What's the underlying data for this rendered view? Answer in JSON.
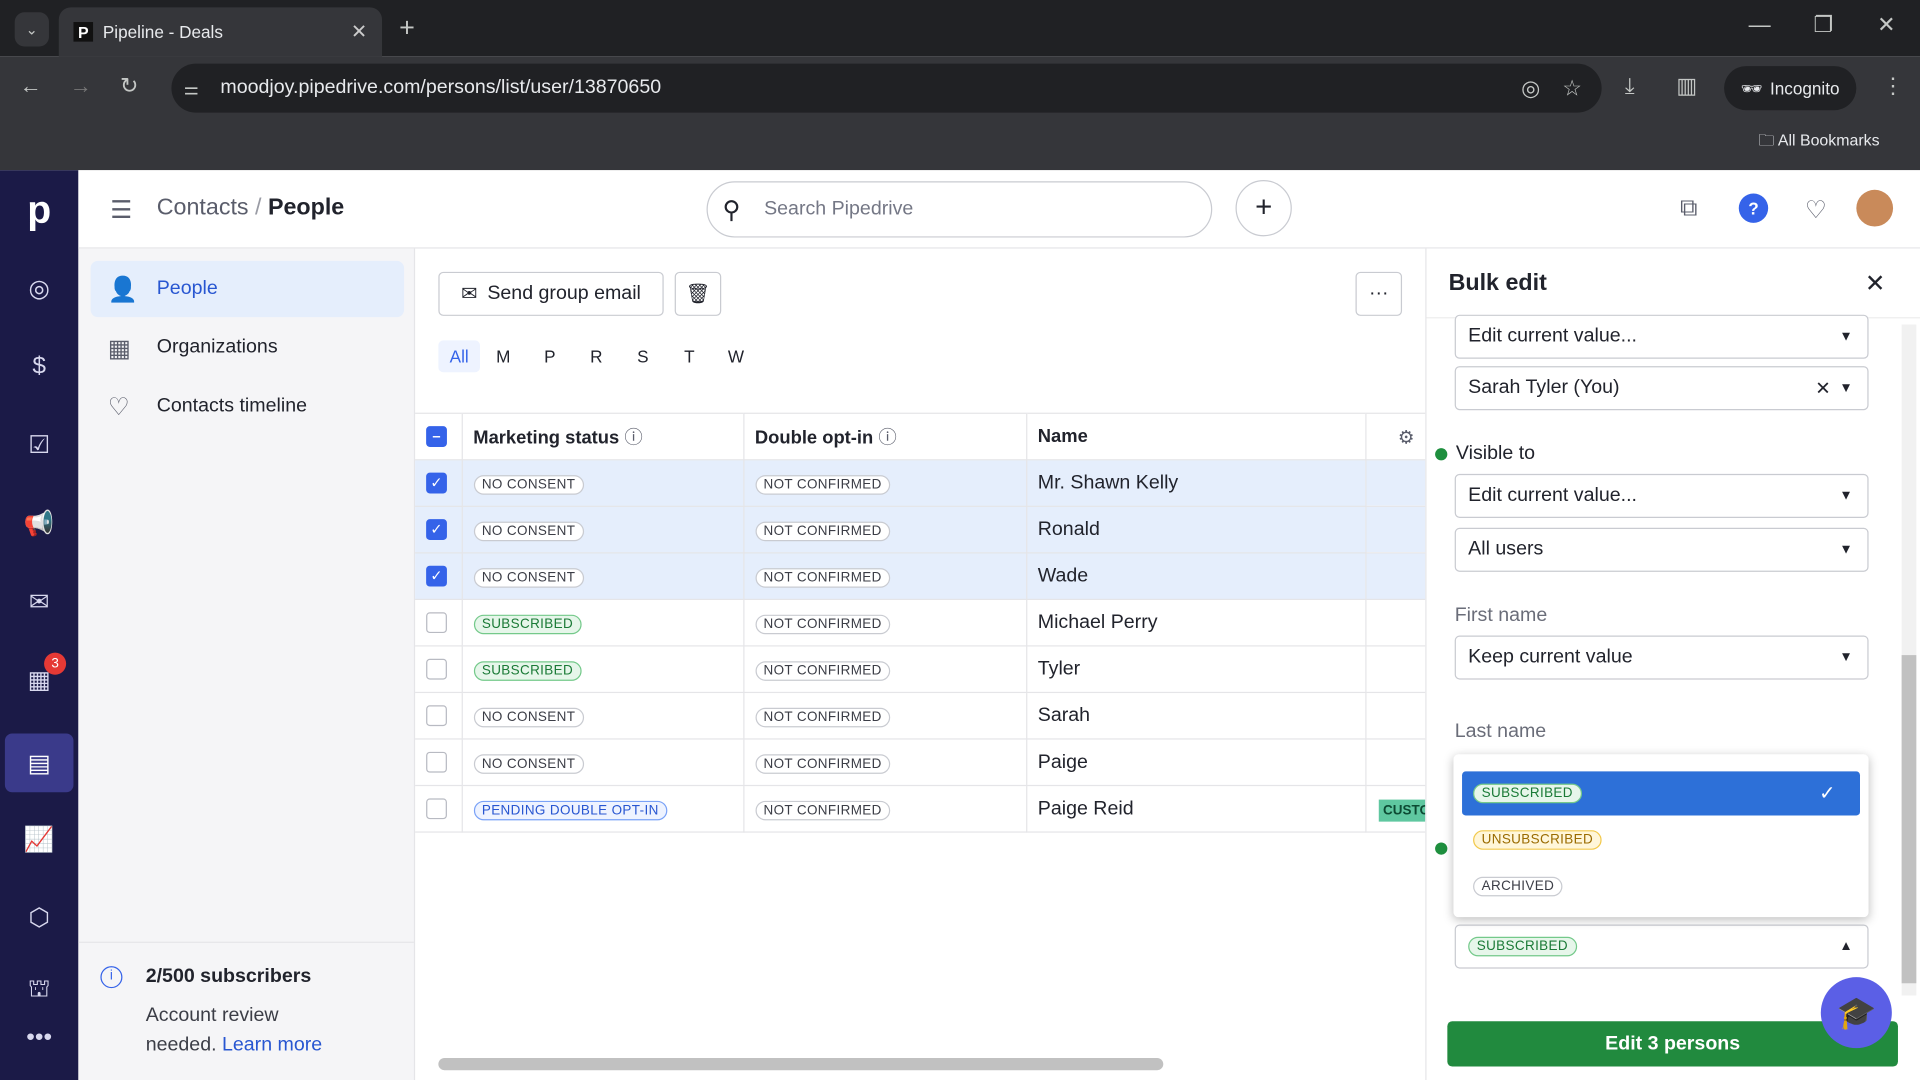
{
  "browser": {
    "tab_title": "Pipeline - Deals",
    "url": "moodjoy.pipedrive.com/persons/list/user/13870650",
    "incognito_label": "Incognito",
    "bookmarks_label": "All Bookmarks"
  },
  "app": {
    "logo": "p",
    "breadcrumb_parent": "Contacts",
    "breadcrumb_sep": "/",
    "breadcrumb_current": "People",
    "search_placeholder": "Search Pipedrive",
    "calendar_badge": "3"
  },
  "sidebar": {
    "items": [
      {
        "label": "People",
        "icon": "person-icon"
      },
      {
        "label": "Organizations",
        "icon": "building-icon"
      },
      {
        "label": "Contacts timeline",
        "icon": "heart-pulse-icon"
      }
    ],
    "subscribers": "2/500 subscribers",
    "review_text": "Account review needed.",
    "learn_more": "Learn more"
  },
  "toolbar": {
    "send_email": "Send group email",
    "more": "···"
  },
  "letters": [
    "All",
    "M",
    "P",
    "R",
    "S",
    "T",
    "W"
  ],
  "table": {
    "headers": [
      "Marketing status",
      "Double opt-in",
      "Name"
    ],
    "rows": [
      {
        "selected": true,
        "status": "NO CONSENT",
        "optin": "NOT CONFIRMED",
        "name": "Mr. Shawn Kelly"
      },
      {
        "selected": true,
        "status": "NO CONSENT",
        "optin": "NOT CONFIRMED",
        "name": "Ronald"
      },
      {
        "selected": true,
        "status": "NO CONSENT",
        "optin": "NOT CONFIRMED",
        "name": "Wade"
      },
      {
        "selected": false,
        "status": "SUBSCRIBED",
        "optin": "NOT CONFIRMED",
        "name": "Michael Perry"
      },
      {
        "selected": false,
        "status": "SUBSCRIBED",
        "optin": "NOT CONFIRMED",
        "name": "Tyler"
      },
      {
        "selected": false,
        "status": "NO CONSENT",
        "optin": "NOT CONFIRMED",
        "name": "Sarah"
      },
      {
        "selected": false,
        "status": "NO CONSENT",
        "optin": "NOT CONFIRMED",
        "name": "Paige"
      },
      {
        "selected": false,
        "status": "PENDING DOUBLE OPT-IN",
        "optin": "NOT CONFIRMED",
        "name": "Paige Reid",
        "extra": "CUSTO"
      }
    ]
  },
  "bulk_edit": {
    "title": "Bulk edit",
    "owner_mode": "Edit current value...",
    "owner_value": "Sarah Tyler (You)",
    "visible_to_label": "Visible to",
    "visible_mode": "Edit current value...",
    "visible_value": "All users",
    "first_name_label": "First name",
    "first_name_value": "Keep current value",
    "last_name_label": "Last name",
    "dropdown_options": [
      "SUBSCRIBED",
      "UNSUBSCRIBED",
      "ARCHIVED"
    ],
    "selected_option": "SUBSCRIBED",
    "field_value": "SUBSCRIBED",
    "submit": "Edit 3 persons"
  },
  "colors": {
    "nav_bg": "#1b1a47",
    "accent": "#3563e9",
    "submit_green": "#218a3e",
    "selected_option": "#2d70d8"
  }
}
